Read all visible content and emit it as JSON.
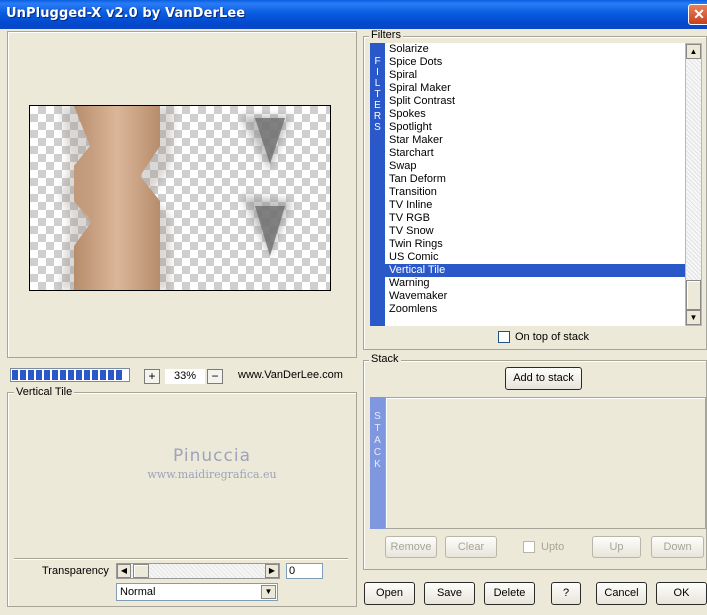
{
  "window": {
    "title": "UnPlugged-X v2.0 by VanDerLee",
    "close_glyph": "✕"
  },
  "preview": {
    "zoom_plus": "+",
    "zoom_level": "33%",
    "zoom_minus": "−",
    "website": "www.VanDerLee.com"
  },
  "settings": {
    "group_label": "Vertical Tile",
    "watermark_line1": "Pinuccia",
    "watermark_line2": "www.maidiregrafica.eu",
    "transparency_label": "Transparency",
    "transparency_value": "0",
    "blend_mode": "Normal"
  },
  "filters": {
    "group_label": "Filters",
    "strip_letters": [
      "F",
      "I",
      "L",
      "T",
      "E",
      "R",
      "S"
    ],
    "items": [
      "Solarize",
      "Spice Dots",
      "Spiral",
      "Spiral Maker",
      "Split Contrast",
      "Spokes",
      "Spotlight",
      "Star Maker",
      "Starchart",
      "Swap",
      "Tan Deform",
      "Transition",
      "TV Inline",
      "TV RGB",
      "TV Snow",
      "Twin Rings",
      "US Comic",
      "Vertical Tile",
      "Warning",
      "Wavemaker",
      "Zoomlens"
    ],
    "selected": "Vertical Tile",
    "on_top_label": "On top of stack"
  },
  "stack": {
    "group_label": "Stack",
    "add_label": "Add to stack",
    "strip_letters": [
      "S",
      "T",
      "A",
      "C",
      "K"
    ],
    "remove_label": "Remove",
    "clear_label": "Clear",
    "upto_label": "Upto",
    "up_label": "Up",
    "down_label": "Down"
  },
  "footer": {
    "open_label": "Open",
    "save_label": "Save",
    "delete_label": "Delete",
    "help_label": "?",
    "cancel_label": "Cancel",
    "ok_label": "OK"
  },
  "icons": {
    "scroll_up": "▲",
    "scroll_down": "▼",
    "scroll_left": "◀",
    "scroll_right": "▶",
    "dropdown": "▼"
  },
  "colors": {
    "titlebar": "#0a5ce0",
    "selection": "#2b58c8",
    "face": "#ece9d8"
  }
}
